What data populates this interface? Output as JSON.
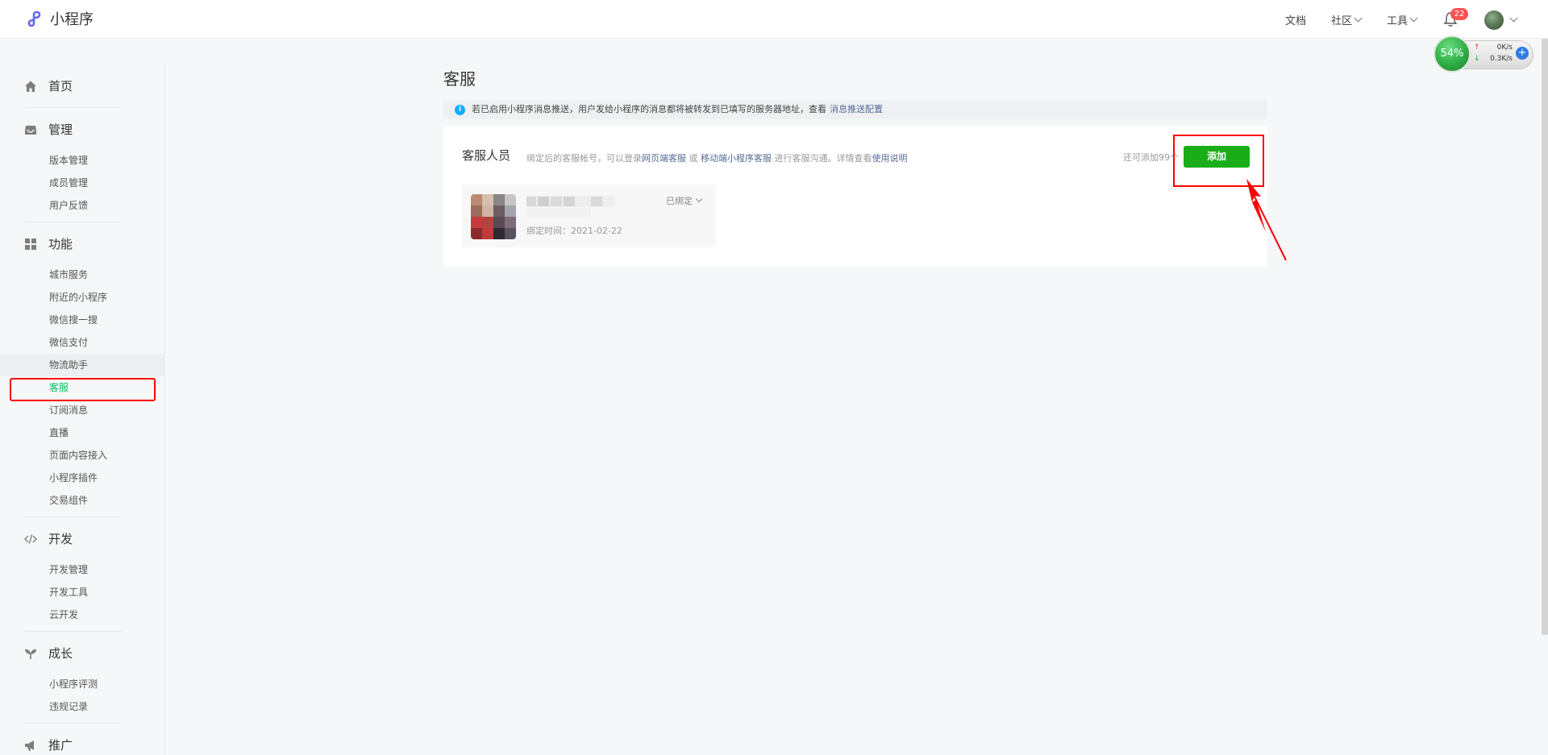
{
  "header": {
    "brand_name": "小程序",
    "nav": [
      {
        "label": "文档",
        "has_dropdown": false
      },
      {
        "label": "社区",
        "has_dropdown": true
      },
      {
        "label": "工具",
        "has_dropdown": true
      }
    ],
    "notification_count": "22"
  },
  "speed_widget": {
    "percent": "54%",
    "upload": "0K/s",
    "download": "0.3K/s",
    "up_arrow": "↑",
    "down_arrow": "↓",
    "plus": "+"
  },
  "sidebar": {
    "groups": [
      {
        "label": "首页",
        "icon": "home-icon",
        "items": []
      },
      {
        "label": "管理",
        "icon": "inbox-icon",
        "items": [
          "版本管理",
          "成员管理",
          "用户反馈"
        ]
      },
      {
        "label": "功能",
        "icon": "grid-icon",
        "items": [
          "城市服务",
          "附近的小程序",
          "微信搜一搜",
          "微信支付",
          "物流助手",
          "客服",
          "订阅消息",
          "直播",
          "页面内容接入",
          "小程序插件",
          "交易组件"
        ]
      },
      {
        "label": "开发",
        "icon": "code-icon",
        "items": [
          "开发管理",
          "开发工具",
          "云开发"
        ]
      },
      {
        "label": "成长",
        "icon": "sprout-icon",
        "items": [
          "小程序评测",
          "违规记录"
        ]
      },
      {
        "label": "推广",
        "icon": "megaphone-icon",
        "items": []
      }
    ],
    "active_item": "客服"
  },
  "main": {
    "page_title": "客服",
    "tip": {
      "text": "若已启用小程序消息推送，用户发给小程序的消息都将被转发到已填写的服务器地址，查看",
      "link": "消息推送配置"
    },
    "card": {
      "title": "客服人员",
      "desc_prefix": "绑定后的客服帐号，可以登录",
      "desc_link1": "网页端客服",
      "desc_or": " 或 ",
      "desc_link2": "移动端小程序客服",
      "desc_mid": " 进行客服沟通。详情查看",
      "desc_link3": "使用说明",
      "quota": "还可添加99个",
      "add_button": "添加",
      "member": {
        "status": "已绑定",
        "bind_time": "绑定时间：2021-02-22"
      }
    }
  },
  "colors": {
    "brand_green": "#1aad19",
    "active_green": "#07c160",
    "link_blue": "#576b95",
    "annotation_red": "#ff0000",
    "badge_red": "#fa5151"
  }
}
